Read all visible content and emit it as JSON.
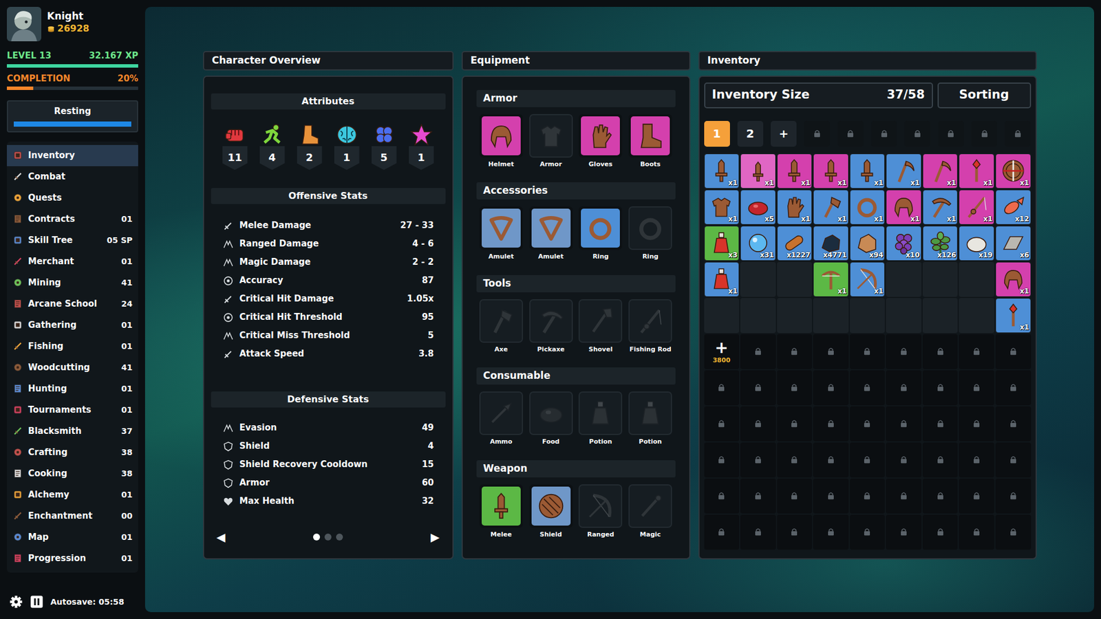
{
  "player": {
    "name": "Knight",
    "gold": "26928",
    "level_label": "LEVEL 13",
    "xp": "32.167 XP",
    "xp_level": 1.0,
    "completion_label": "COMPLETION",
    "completion": "20%",
    "completion_level": 0.2,
    "activity": "Resting",
    "activity_level": 1.0
  },
  "sidebar": {
    "items": [
      {
        "label": "Inventory",
        "selected": true
      },
      {
        "label": "Combat",
        "selected": false
      },
      {
        "label": "Quests",
        "selected": false
      },
      {
        "label": "Contracts",
        "count": "01",
        "selected": false
      },
      {
        "label": "Skill Tree",
        "count": "05 SP",
        "selected": false
      },
      {
        "label": "Merchant",
        "count": "01",
        "selected": false
      },
      {
        "label": "Mining",
        "count": "41",
        "selected": false
      },
      {
        "label": "Arcane School",
        "count": "24",
        "selected": false
      },
      {
        "label": "Gathering",
        "count": "01",
        "selected": false
      },
      {
        "label": "Fishing",
        "count": "01",
        "selected": false
      },
      {
        "label": "Woodcutting",
        "count": "41",
        "selected": false
      },
      {
        "label": "Hunting",
        "count": "01",
        "selected": false
      },
      {
        "label": "Tournaments",
        "count": "01",
        "selected": false
      },
      {
        "label": "Blacksmith",
        "count": "37",
        "selected": false
      },
      {
        "label": "Crafting",
        "count": "38",
        "selected": false
      },
      {
        "label": "Cooking",
        "count": "38",
        "selected": false
      },
      {
        "label": "Alchemy",
        "count": "01",
        "selected": false
      },
      {
        "label": "Enchantment",
        "count": "00",
        "selected": false
      },
      {
        "label": "Map",
        "count": "01",
        "selected": false
      },
      {
        "label": "Progression",
        "count": "01",
        "selected": false
      }
    ]
  },
  "footer": {
    "autosave": "Autosave: 05:58"
  },
  "overview": {
    "title": "Character Overview",
    "attributes_heading": "Attributes",
    "attributes": [
      {
        "kind": "fist",
        "value": "11",
        "color": "#e0383e"
      },
      {
        "kind": "run",
        "value": "4",
        "color": "#7ed63c"
      },
      {
        "kind": "boot",
        "value": "2",
        "color": "#e8923a"
      },
      {
        "kind": "brain",
        "value": "1",
        "color": "#3cc8e0"
      },
      {
        "kind": "clover",
        "value": "5",
        "color": "#4a6ef0"
      },
      {
        "kind": "star",
        "value": "1",
        "color": "#e84ad0"
      }
    ],
    "offensive_heading": "Offensive Stats",
    "offensive": [
      {
        "label": "Melee Damage",
        "value": "27 - 33"
      },
      {
        "label": "Ranged Damage",
        "value": "4 - 6"
      },
      {
        "label": "Magic Damage",
        "value": "2 - 2"
      },
      {
        "label": "Accuracy",
        "value": "87"
      },
      {
        "label": "Critical Hit Damage",
        "value": "1.05x"
      },
      {
        "label": "Critical Hit Threshold",
        "value": "95"
      },
      {
        "label": "Critical Miss Threshold",
        "value": "5"
      },
      {
        "label": "Attack Speed",
        "value": "3.8"
      }
    ],
    "defensive_heading": "Defensive Stats",
    "defensive": [
      {
        "label": "Evasion",
        "value": "49"
      },
      {
        "label": "Shield",
        "value": "4"
      },
      {
        "label": "Shield Recovery Cooldown",
        "value": "15"
      },
      {
        "label": "Armor",
        "value": "60"
      },
      {
        "label": "Max Health",
        "value": "32"
      }
    ],
    "pager": {
      "prev": "◀",
      "next": "▶",
      "pages": [
        {
          "selected": true
        },
        {
          "selected": false
        },
        {
          "selected": false
        }
      ]
    }
  },
  "equipment": {
    "title": "Equipment",
    "sections": [
      {
        "title": "Armor",
        "slots": [
          {
            "label": "Helmet",
            "kind": "helmet",
            "equipped": true,
            "color": "#d440ad"
          },
          {
            "label": "Armor",
            "kind": "chest",
            "equipped": false
          },
          {
            "label": "Gloves",
            "kind": "glove",
            "equipped": true,
            "color": "#d440ad"
          },
          {
            "label": "Boots",
            "kind": "boot",
            "equipped": true,
            "color": "#d440ad"
          }
        ]
      },
      {
        "title": "Accessories",
        "slots": [
          {
            "label": "Amulet",
            "kind": "amulet",
            "equipped": true,
            "color": "#6f97c8"
          },
          {
            "label": "Amulet",
            "kind": "amulet",
            "equipped": true,
            "color": "#6f97c8"
          },
          {
            "label": "Ring",
            "kind": "ring",
            "equipped": true,
            "color": "#4e8fd6"
          },
          {
            "label": "Ring",
            "kind": "ring",
            "equipped": false
          }
        ]
      },
      {
        "title": "Tools",
        "slots": [
          {
            "label": "Axe",
            "kind": "axe",
            "equipped": false
          },
          {
            "label": "Pickaxe",
            "kind": "pickaxe",
            "equipped": false
          },
          {
            "label": "Shovel",
            "kind": "shovel",
            "equipped": false
          },
          {
            "label": "Fishing Rod",
            "kind": "rod",
            "equipped": false
          }
        ]
      },
      {
        "title": "Consumable",
        "slots": [
          {
            "label": "Ammo",
            "kind": "ammo",
            "equipped": false
          },
          {
            "label": "Food",
            "kind": "food",
            "equipped": false
          },
          {
            "label": "Potion",
            "kind": "potion",
            "equipped": false
          },
          {
            "label": "Potion",
            "kind": "potion",
            "equipped": false
          }
        ]
      },
      {
        "title": "Weapon",
        "slots": [
          {
            "label": "Melee",
            "kind": "sword",
            "equipped": true,
            "color": "#5cb845"
          },
          {
            "label": "Shield",
            "kind": "shield",
            "equipped": true,
            "color": "#6f97c8"
          },
          {
            "label": "Ranged",
            "kind": "bow",
            "equipped": false
          },
          {
            "label": "Magic",
            "kind": "wand",
            "equipped": false
          }
        ]
      }
    ]
  },
  "inventory": {
    "title": "Inventory",
    "size_label": "Inventory Size",
    "size": "37/58",
    "sorting": "Sorting",
    "tabs": [
      {
        "label": "1",
        "kind": "page",
        "selected": true
      },
      {
        "label": "2",
        "kind": "page",
        "selected": false
      },
      {
        "label": "+",
        "kind": "add",
        "selected": false
      },
      {
        "kind": "locked",
        "selected": false
      },
      {
        "kind": "locked",
        "selected": false
      },
      {
        "kind": "locked",
        "selected": false
      },
      {
        "kind": "locked",
        "selected": false
      },
      {
        "kind": "locked",
        "selected": false
      },
      {
        "kind": "locked",
        "selected": false
      },
      {
        "kind": "locked",
        "selected": false
      }
    ],
    "slots": [
      {
        "kind": "sword",
        "color": "#4e8fd6",
        "count": "x1"
      },
      {
        "kind": "dagger",
        "color": "#e066c4",
        "count": "x1"
      },
      {
        "kind": "sword",
        "color": "#d440ad",
        "count": "x1"
      },
      {
        "kind": "sword",
        "color": "#d440ad",
        "count": "x1"
      },
      {
        "kind": "sword",
        "color": "#4e8fd6",
        "count": "x1"
      },
      {
        "kind": "scythe",
        "color": "#4e8fd6",
        "count": "x1"
      },
      {
        "kind": "scythe",
        "color": "#d440ad",
        "count": "x1"
      },
      {
        "kind": "staff",
        "color": "#d440ad",
        "count": "x1"
      },
      {
        "kind": "buckler",
        "color": "#d440ad",
        "count": "x1"
      },
      {
        "kind": "chest",
        "color": "#4e8fd6",
        "count": "x1"
      },
      {
        "kind": "food",
        "color": "#4e8fd6",
        "count": "x5"
      },
      {
        "kind": "glove",
        "color": "#4e8fd6",
        "count": "x1"
      },
      {
        "kind": "axe",
        "color": "#4e8fd6",
        "count": "x1"
      },
      {
        "kind": "ring",
        "color": "#4e8fd6",
        "count": "x1"
      },
      {
        "kind": "helmet",
        "color": "#d440ad",
        "count": "x1"
      },
      {
        "kind": "pickaxe",
        "color": "#4e8fd6",
        "count": "x1"
      },
      {
        "kind": "rod",
        "color": "#d440ad",
        "count": "x1"
      },
      {
        "kind": "fish",
        "color": "#4e8fd6",
        "count": "x12"
      },
      {
        "kind": "potion",
        "color": "#5cb845",
        "count": "x3"
      },
      {
        "kind": "orb",
        "color": "#4e8fd6",
        "count": "x31"
      },
      {
        "kind": "wood",
        "color": "#4e8fd6",
        "count": "x1227"
      },
      {
        "kind": "coal",
        "color": "#4e8fd6",
        "count": "x4771"
      },
      {
        "kind": "ore",
        "color": "#4e8fd6",
        "count": "x94"
      },
      {
        "kind": "grapes",
        "color": "#4e8fd6",
        "count": "x10"
      },
      {
        "kind": "herb",
        "color": "#4e8fd6",
        "count": "x126"
      },
      {
        "kind": "rock",
        "color": "#4e8fd6",
        "count": "x19"
      },
      {
        "kind": "bar",
        "color": "#4e8fd6",
        "count": "x6"
      },
      {
        "kind": "potion",
        "color": "#4e8fd6",
        "count": "x1"
      },
      {
        "kind": "empty"
      },
      {
        "kind": "empty"
      },
      {
        "kind": "crossbow",
        "color": "#5cb845",
        "count": "x1"
      },
      {
        "kind": "bow",
        "color": "#4e8fd6",
        "count": "x1"
      },
      {
        "kind": "empty"
      },
      {
        "kind": "empty"
      },
      {
        "kind": "empty"
      },
      {
        "kind": "helmet",
        "color": "#d440ad",
        "count": "x1"
      },
      {
        "kind": "empty"
      },
      {
        "kind": "empty"
      },
      {
        "kind": "empty"
      },
      {
        "kind": "empty"
      },
      {
        "kind": "empty"
      },
      {
        "kind": "empty"
      },
      {
        "kind": "empty"
      },
      {
        "kind": "empty"
      },
      {
        "kind": "staff",
        "color": "#4e8fd6",
        "count": "x1"
      },
      {
        "kind": "buy",
        "label": "+",
        "price": "3800"
      },
      {
        "kind": "locked"
      },
      {
        "kind": "locked"
      },
      {
        "kind": "locked"
      },
      {
        "kind": "locked"
      },
      {
        "kind": "locked"
      },
      {
        "kind": "locked"
      },
      {
        "kind": "locked"
      },
      {
        "kind": "locked"
      },
      {
        "kind": "locked"
      },
      {
        "kind": "locked"
      },
      {
        "kind": "locked"
      },
      {
        "kind": "locked"
      },
      {
        "kind": "locked"
      },
      {
        "kind": "locked"
      },
      {
        "kind": "locked"
      },
      {
        "kind": "locked"
      },
      {
        "kind": "locked"
      },
      {
        "kind": "locked"
      },
      {
        "kind": "locked"
      },
      {
        "kind": "locked"
      },
      {
        "kind": "locked"
      },
      {
        "kind": "locked"
      },
      {
        "kind": "locked"
      },
      {
        "kind": "locked"
      },
      {
        "kind": "locked"
      },
      {
        "kind": "locked"
      },
      {
        "kind": "locked"
      },
      {
        "kind": "locked"
      },
      {
        "kind": "locked"
      },
      {
        "kind": "locked"
      },
      {
        "kind": "locked"
      },
      {
        "kind": "locked"
      },
      {
        "kind": "locked"
      },
      {
        "kind": "locked"
      },
      {
        "kind": "locked"
      },
      {
        "kind": "locked"
      },
      {
        "kind": "locked"
      },
      {
        "kind": "locked"
      },
      {
        "kind": "locked"
      },
      {
        "kind": "locked"
      },
      {
        "kind": "locked"
      },
      {
        "kind": "locked"
      },
      {
        "kind": "locked"
      },
      {
        "kind": "locked"
      },
      {
        "kind": "locked"
      },
      {
        "kind": "locked"
      },
      {
        "kind": "locked"
      },
      {
        "kind": "locked"
      },
      {
        "kind": "locked"
      },
      {
        "kind": "locked"
      },
      {
        "kind": "locked"
      },
      {
        "kind": "locked"
      },
      {
        "kind": "locked"
      }
    ]
  }
}
